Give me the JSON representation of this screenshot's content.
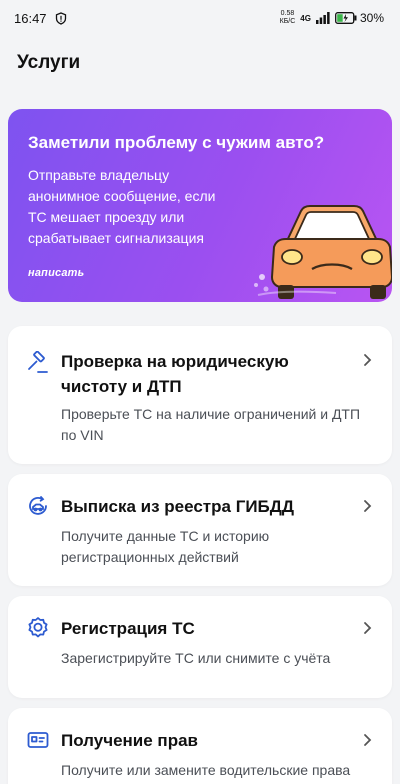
{
  "status": {
    "time": "16:47",
    "speed_value": "0.58",
    "speed_unit": "КБ/С",
    "network": "4G",
    "battery": "30%"
  },
  "page": {
    "title": "Услуги"
  },
  "promo": {
    "title": "Заметили проблему с чужим авто?",
    "text": "Отправьте владельцу анонимное сообщение, если ТС мешает проезду или срабатывает сигнализация",
    "action": "написать",
    "bg_color": "#8b52f0"
  },
  "services": [
    {
      "title": "Проверка на юридическую чистоту и ДТП",
      "subtitle": "Проверьте ТС на наличие ограничений и ДТП по VIN",
      "icon": "gavel-icon"
    },
    {
      "title": "Выписка из реестра ГИБДД",
      "subtitle": "Получите данные ТС и историю регистрационных действий",
      "icon": "registry-icon"
    },
    {
      "title": "Регистрация ТС",
      "subtitle": "Зарегистрируйте ТС или снимите с учёта",
      "icon": "badge-icon"
    },
    {
      "title": "Получение прав",
      "subtitle": "Получите или замените водительские права",
      "icon": "id-card-icon"
    }
  ],
  "accent_color": "#2d5bd0"
}
